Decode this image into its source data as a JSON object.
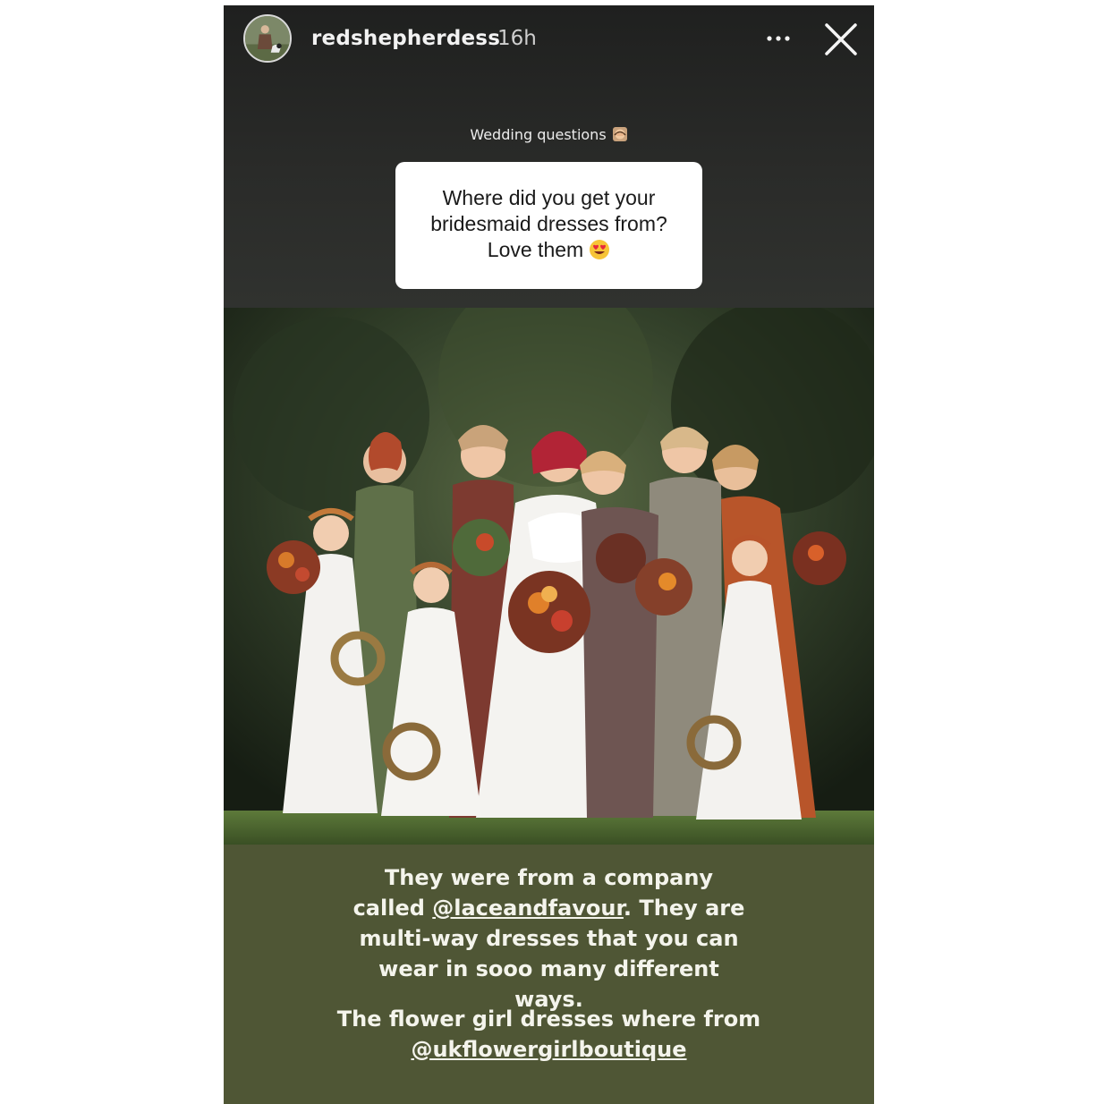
{
  "header": {
    "username": "redshepherdess",
    "time": "16h",
    "avatar_icon": "profile-avatar",
    "more_icon": "more-horizontal-icon",
    "close_icon": "close-icon"
  },
  "question": {
    "label": "Wedding questions",
    "label_emoji": "woman-facepalming-emoji",
    "line1": "Where did you get your",
    "line2": "bridesmaid dresses from?",
    "line3": "Love them",
    "line3_emoji": "heart-eyes-emoji"
  },
  "photo": {
    "icon": "wedding-group-photo"
  },
  "answer": {
    "p1_a": "They were from a company called ",
    "p1_mention": "@laceandfavour",
    "p1_b": ". They are multi-way dresses that you can wear in sooo many different ways.",
    "p2_a": "The flower girl dresses where from ",
    "p2_mention": "@ukflowergirlboutique"
  },
  "colors": {
    "story_bg": "#2b2d2a",
    "answer_bg": "#4f5635",
    "card_bg": "#ffffff",
    "text_light": "#f4f4ec"
  }
}
